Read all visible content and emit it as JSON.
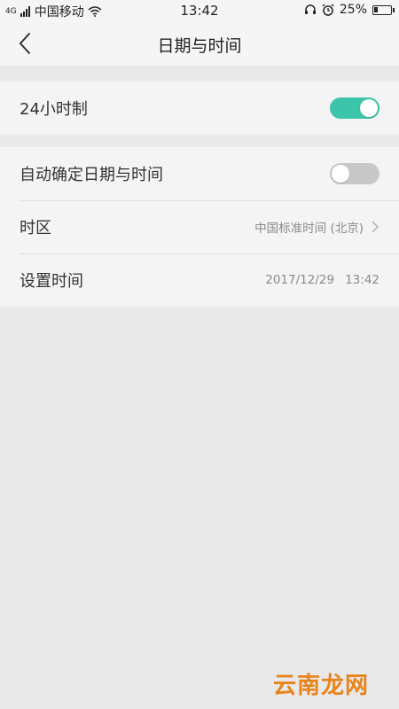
{
  "status_bar": {
    "signal_label": "4G",
    "carrier": "中国移动",
    "time": "13:42",
    "battery": "25%",
    "battery_level": 0.25
  },
  "header": {
    "title": "日期与时间"
  },
  "settings": {
    "hour24": {
      "label": "24小时制",
      "enabled": true
    },
    "auto": {
      "label": "自动确定日期与时间",
      "enabled": false
    },
    "timezone": {
      "label": "时区",
      "value": "中国标准时间 (北京)"
    },
    "set_time": {
      "label": "设置时间",
      "date": "2017/12/29",
      "time": "13:42"
    }
  },
  "colors": {
    "toggle_on": "#3cc5a8",
    "toggle_off": "#c8c8c8",
    "watermark": "#e8841c"
  },
  "watermark": "云南龙网"
}
